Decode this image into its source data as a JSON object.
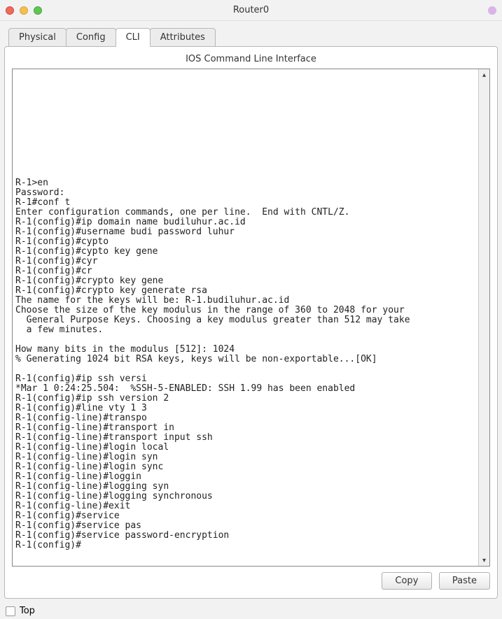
{
  "window": {
    "title": "Router0"
  },
  "tabs": {
    "items": [
      {
        "label": "Physical"
      },
      {
        "label": "Config"
      },
      {
        "label": "CLI"
      },
      {
        "label": "Attributes"
      }
    ],
    "active_index": 2
  },
  "panel": {
    "title": "IOS Command Line Interface"
  },
  "terminal": {
    "text": "\n\n\n\n\n\n\n\n\n\n\nR-1>en\nPassword:\nR-1#conf t\nEnter configuration commands, one per line.  End with CNTL/Z.\nR-1(config)#ip domain name budiluhur.ac.id\nR-1(config)#username budi password luhur\nR-1(config)#cypto\nR-1(config)#cypto key gene\nR-1(config)#cyr\nR-1(config)#cr\nR-1(config)#crypto key gene\nR-1(config)#crypto key generate rsa\nThe name for the keys will be: R-1.budiluhur.ac.id\nChoose the size of the key modulus in the range of 360 to 2048 for your\n  General Purpose Keys. Choosing a key modulus greater than 512 may take\n  a few minutes.\n\nHow many bits in the modulus [512]: 1024\n% Generating 1024 bit RSA keys, keys will be non-exportable...[OK]\n\nR-1(config)#ip ssh versi\n*Mar 1 0:24:25.504:  %SSH-5-ENABLED: SSH 1.99 has been enabled\nR-1(config)#ip ssh version 2\nR-1(config)#line vty 1 3\nR-1(config-line)#transpo\nR-1(config-line)#transport in\nR-1(config-line)#transport input ssh\nR-1(config-line)#login local\nR-1(config-line)#login syn\nR-1(config-line)#login sync\nR-1(config-line)#loggin\nR-1(config-line)#logging syn\nR-1(config-line)#logging synchronous\nR-1(config-line)#exit\nR-1(config)#service\nR-1(config)#service pas\nR-1(config)#service password-encryption\nR-1(config)#"
  },
  "buttons": {
    "copy": "Copy",
    "paste": "Paste"
  },
  "bottom": {
    "top_label": "Top"
  }
}
